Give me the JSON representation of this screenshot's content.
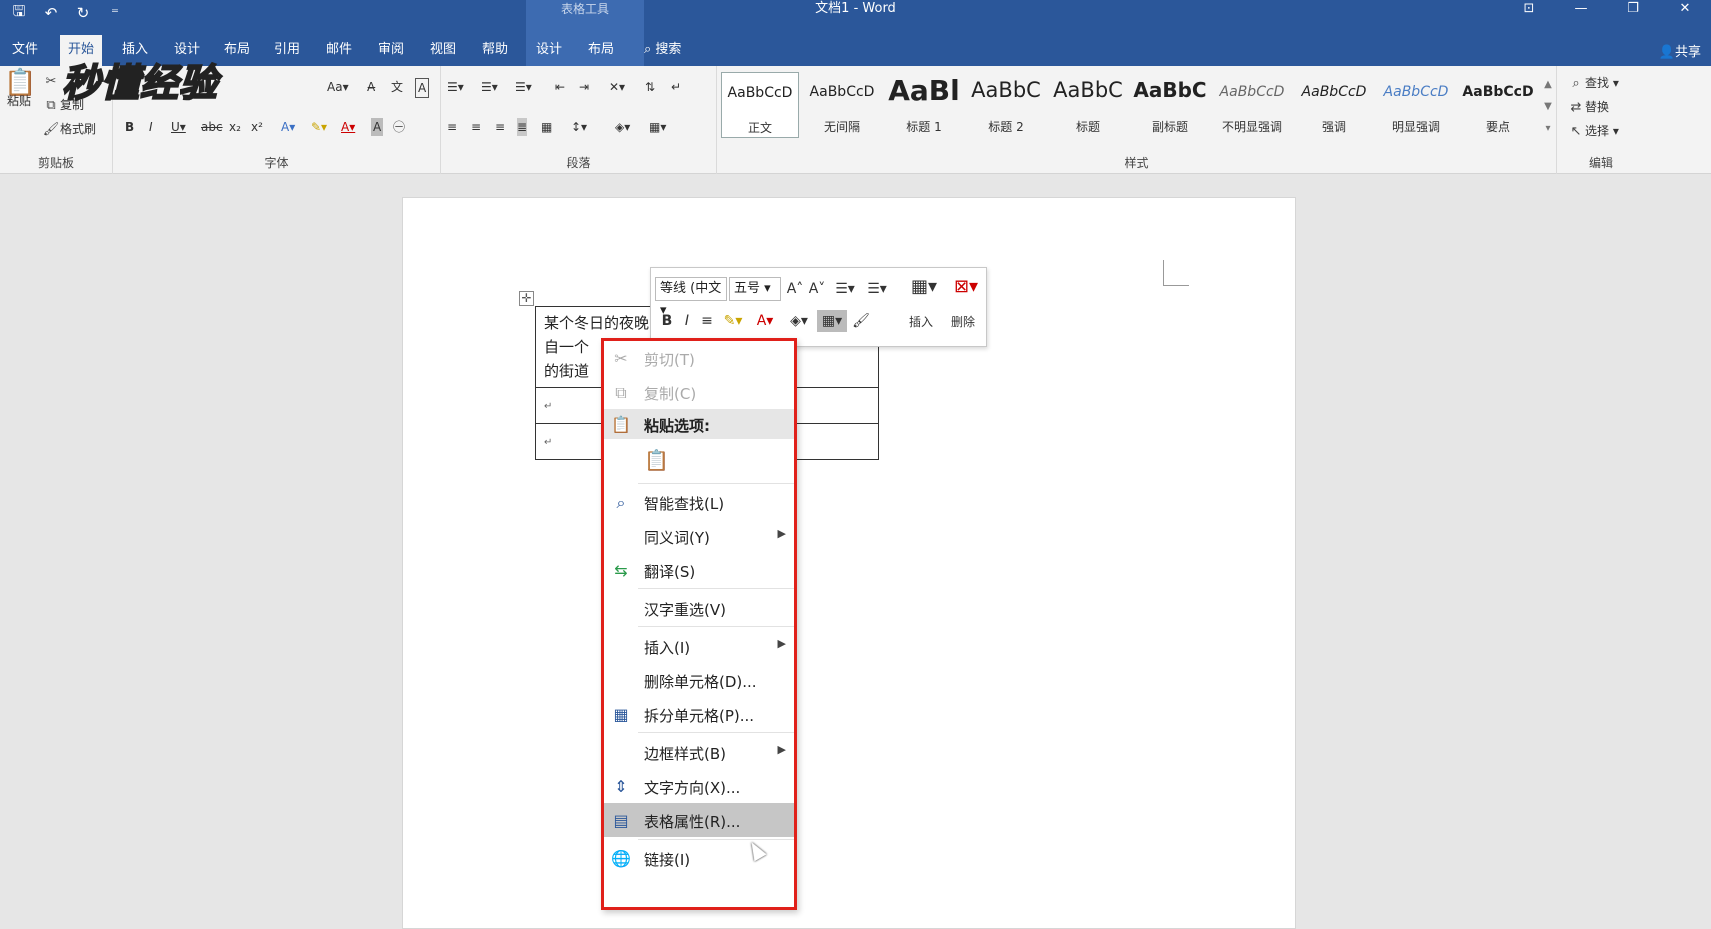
{
  "titlebar": {
    "context_tools": "表格工具",
    "doc_title": "文档1 - Word"
  },
  "tabs": [
    "文件",
    "开始",
    "插入",
    "设计",
    "布局",
    "引用",
    "邮件",
    "审阅",
    "视图",
    "帮助",
    "设计",
    "布局"
  ],
  "search_label": "搜索",
  "share_label": "共享",
  "ribbon": {
    "clipboard": {
      "paste": "粘贴",
      "copy": "复制",
      "format_painter": "格式刷",
      "label": "剪贴板"
    },
    "font": {
      "label": "字体"
    },
    "paragraph": {
      "label": "段落"
    },
    "styles": {
      "label": "样式",
      "items": [
        {
          "sample": "AaBbCcD",
          "name": "正文"
        },
        {
          "sample": "AaBbCcD",
          "name": "无间隔"
        },
        {
          "sample": "AaBl",
          "name": "标题 1"
        },
        {
          "sample": "AaBbC",
          "name": "标题 2"
        },
        {
          "sample": "AaBbC",
          "name": "标题"
        },
        {
          "sample": "AaBbC",
          "name": "副标题"
        },
        {
          "sample": "AaBbCcD",
          "name": "不明显强调"
        },
        {
          "sample": "AaBbCcD",
          "name": "强调"
        },
        {
          "sample": "AaBbCcD",
          "name": "明显强调"
        },
        {
          "sample": "AaBbCcD",
          "name": "要点"
        }
      ]
    },
    "editing": {
      "find": "查找",
      "replace": "替换",
      "select": "选择",
      "label": "编辑"
    }
  },
  "watermark": "秒懂经验",
  "table": {
    "cell_text_lines": [
      "某个冬日的夜晚",
      "自一个",
      "的街道"
    ]
  },
  "minibar": {
    "font_name": "等线 (中文",
    "font_size": "五号",
    "insert": "插入",
    "delete": "删除"
  },
  "context_menu": {
    "items": [
      {
        "label": "剪切(T)",
        "icon": "cut-icon"
      },
      {
        "label": "复制(C)",
        "icon": "copy-icon"
      },
      {
        "label": "粘贴选项:",
        "icon": "paste-icon"
      },
      {
        "label": "智能查找(L)",
        "icon": "smart-lookup-icon"
      },
      {
        "label": "同义词(Y)",
        "icon": ""
      },
      {
        "label": "翻译(S)",
        "icon": "translate-icon"
      },
      {
        "label": "汉字重选(V)",
        "icon": ""
      },
      {
        "label": "插入(I)",
        "icon": ""
      },
      {
        "label": "删除单元格(D)...",
        "icon": ""
      },
      {
        "label": "拆分单元格(P)...",
        "icon": "split-cells-icon"
      },
      {
        "label": "边框样式(B)",
        "icon": ""
      },
      {
        "label": "文字方向(X)...",
        "icon": "text-direction-icon"
      },
      {
        "label": "表格属性(R)...",
        "icon": "table-properties-icon"
      },
      {
        "label": "链接(I)",
        "icon": "link-icon"
      }
    ]
  },
  "colors": {
    "brand": "#2b579a",
    "highlight_border": "#e0201a"
  }
}
